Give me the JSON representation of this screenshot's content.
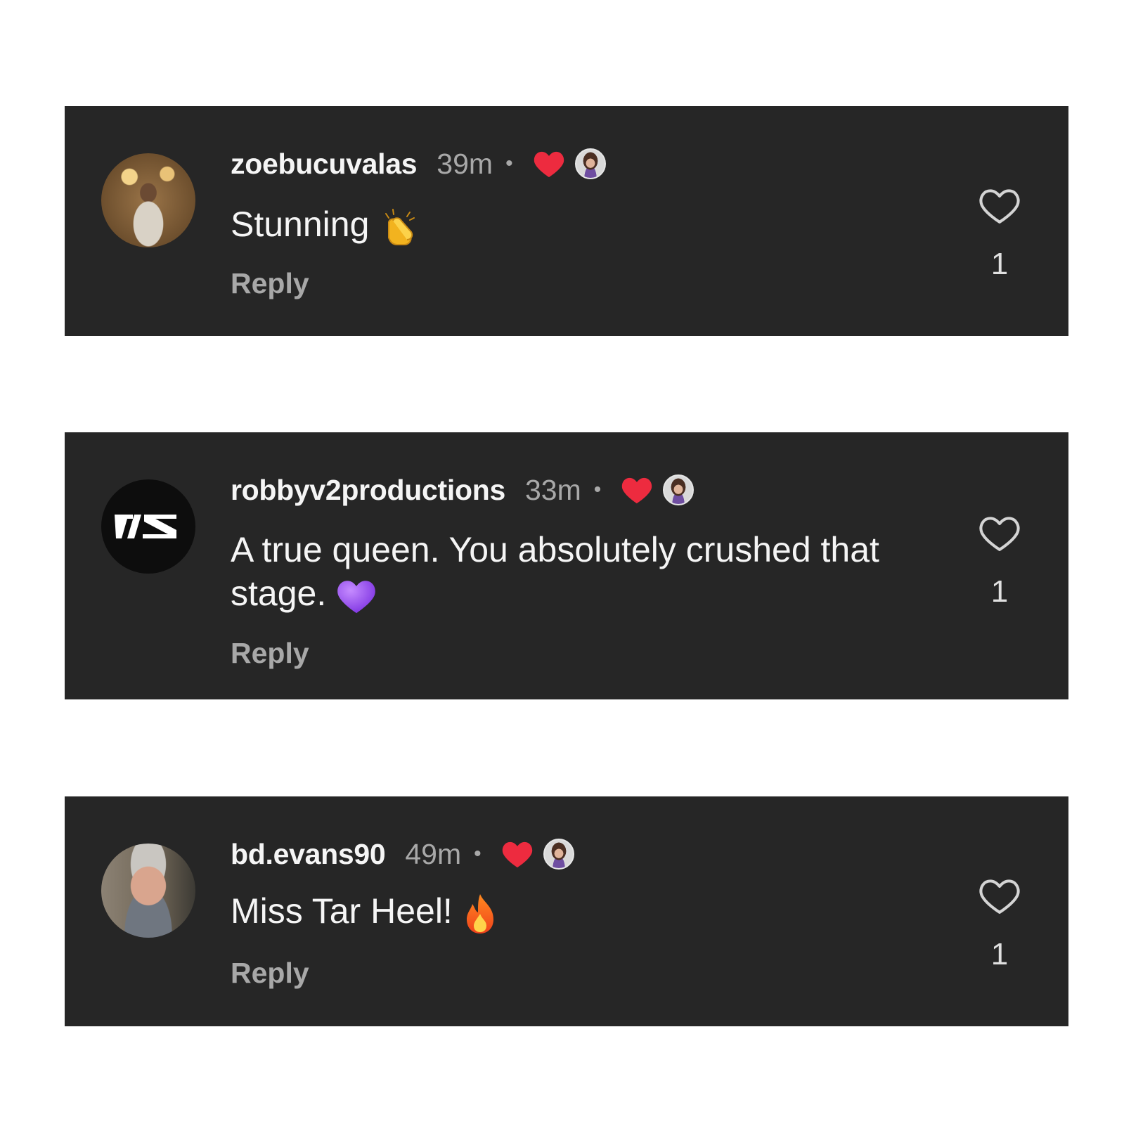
{
  "comments": [
    {
      "username": "zoebucuvalas",
      "time": "39m",
      "separator": "•",
      "text": "Stunning",
      "emoji": "clapping-hands",
      "reply_label": "Reply",
      "like_count": "1",
      "liked_by_creator": true
    },
    {
      "username": "robbyv2productions",
      "time": "33m",
      "separator": "•",
      "text": "A true queen. You absolutely crushed that stage.",
      "emoji": "purple-heart",
      "reply_label": "Reply",
      "like_count": "1",
      "liked_by_creator": true,
      "avatar_logo_text": "V2"
    },
    {
      "username": "bd.evans90",
      "time": "49m",
      "separator": "•",
      "text": "Miss Tar Heel!",
      "emoji": "fire",
      "reply_label": "Reply",
      "like_count": "1",
      "liked_by_creator": true
    }
  ],
  "colors": {
    "card_background": "#262626",
    "page_background": "#ffffff",
    "primary_text": "#f5f5f5",
    "secondary_text": "#a8a8a8",
    "liked_heart": "#ed2b3f"
  },
  "icons": {
    "creator_like": "filled-heart-icon",
    "like_button": "heart-outline-icon"
  }
}
